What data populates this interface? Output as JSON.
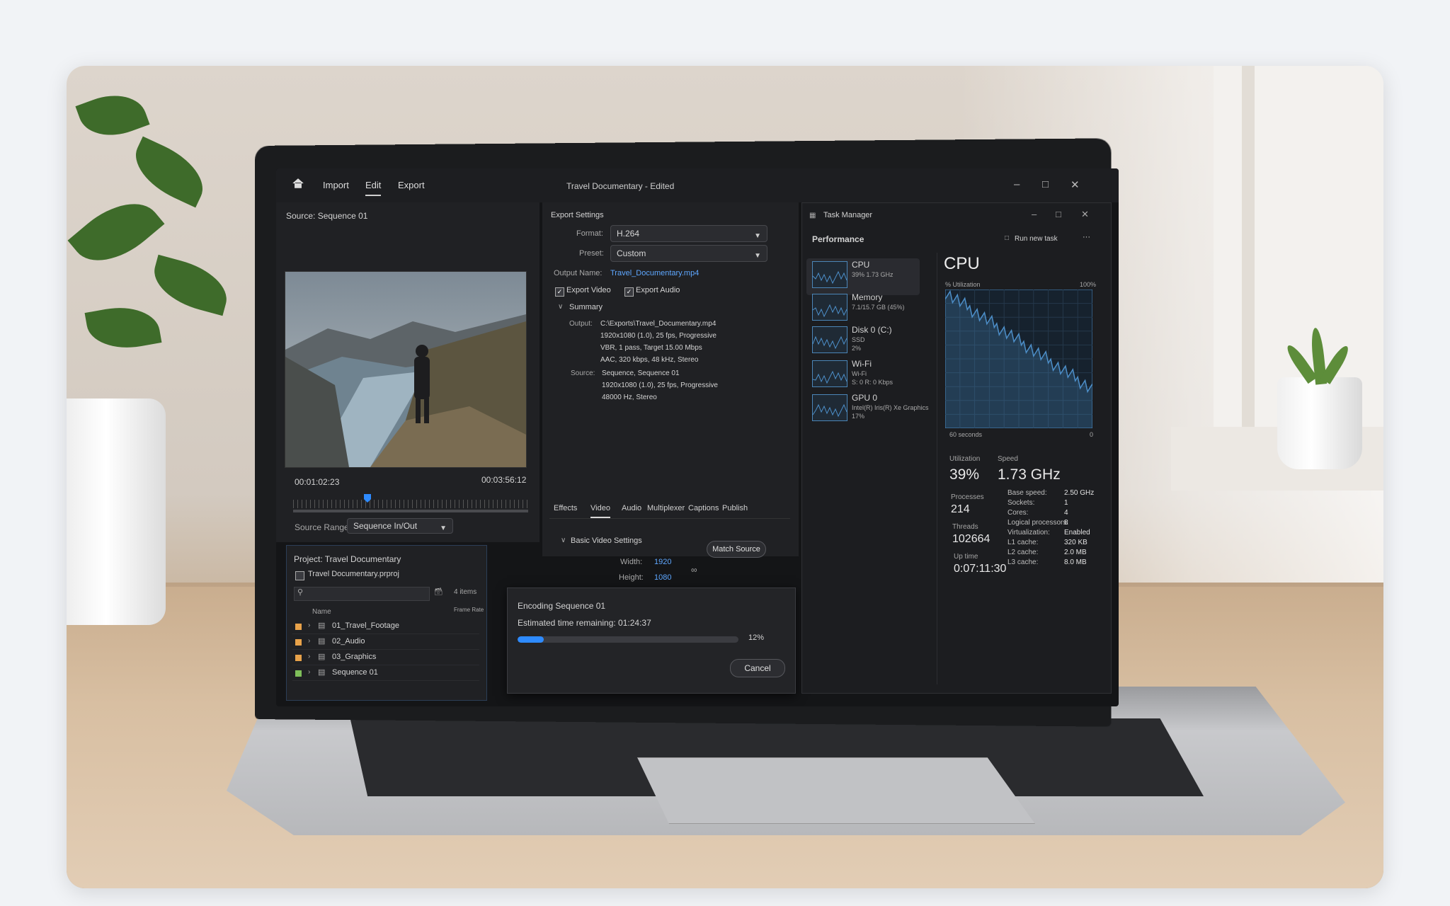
{
  "titlebar": {
    "menu": [
      "Import",
      "Edit",
      "Export"
    ],
    "title": "Travel Documentary - Edited"
  },
  "source_panel": {
    "source_label": "Source: Sequence 01",
    "timecode_current": "00:01:02:23",
    "timecode_total": "00:03:56:12",
    "source_range_label": "Source Range:",
    "source_range_value": "Sequence In/Out"
  },
  "project_panel": {
    "title": "Project: Travel Documentary",
    "project_file": "Travel Documentary.prproj",
    "items_count": "4 items",
    "col_name": "Name",
    "col_rate": "Frame Rate",
    "items": [
      {
        "label": "01_Travel_Footage",
        "color": "#e8a24a"
      },
      {
        "label": "02_Audio",
        "color": "#e8a24a"
      },
      {
        "label": "03_Graphics",
        "color": "#e8a24a"
      },
      {
        "label": "Sequence 01",
        "color": "#7fbf5a"
      }
    ]
  },
  "export_settings": {
    "heading": "Export Settings",
    "format_label": "Format:",
    "format_value": "H.264",
    "preset_label": "Preset:",
    "preset_value": "Custom",
    "output_name_label": "Output Name:",
    "output_name_value": "Travel_Documentary.mp4",
    "export_video_label": "Export Video",
    "export_audio_label": "Export Audio",
    "summary_label": "Summary",
    "output_label": "Output:",
    "output_lines": [
      "C:\\Exports\\Travel_Documentary.mp4",
      "1920x1080 (1.0), 25 fps, Progressive",
      "VBR, 1 pass, Target 15.00 Mbps",
      "AAC, 320 kbps, 48 kHz, Stereo"
    ],
    "source_label": "Source:",
    "source_lines": [
      "Sequence, Sequence 01",
      "1920x1080 (1.0), 25 fps, Progressive",
      "48000 Hz, Stereo"
    ],
    "tabs": [
      "Effects",
      "Video",
      "Audio",
      "Multiplexer",
      "Captions",
      "Publish"
    ],
    "basic_video_label": "Basic Video Settings",
    "match_source_label": "Match Source",
    "width_label": "Width:",
    "width_value": "1920",
    "height_label": "Height:",
    "height_value": "1080"
  },
  "encoding_dialog": {
    "title": "Encoding Sequence 01",
    "remaining": "Estimated time remaining: 01:24:37",
    "percent_label": "12%",
    "progress_fraction": 0.12,
    "cancel_label": "Cancel",
    "accent": "#2e8bff"
  },
  "task_manager": {
    "title": "Task Manager",
    "section": "Performance",
    "run_new_task": "Run new task",
    "more": "···",
    "sidebar": [
      {
        "name": "CPU",
        "detail": "39% 1.73 GHz",
        "detail2": "",
        "detail3": ""
      },
      {
        "name": "Memory",
        "detail": "7.1/15.7 GB (45%)",
        "detail2": "",
        "detail3": ""
      },
      {
        "name": "Disk 0 (C:)",
        "detail": "SSD",
        "detail2": "2%",
        "detail3": ""
      },
      {
        "name": "Wi-Fi",
        "detail": "Wi-Fi",
        "detail2": "S: 0 R: 0 Kbps",
        "detail3": ""
      },
      {
        "name": "GPU 0",
        "detail": "Intel(R) Iris(R) Xe Graphics",
        "detail2": "17%",
        "detail3": ""
      }
    ],
    "cpu_heading": "CPU",
    "util_axis_label": "% Utilization",
    "util_axis_max": "100%",
    "time_axis_label": "60 seconds",
    "time_axis_end": "0",
    "utilization_label": "Utilization",
    "utilization_value": "39%",
    "speed_label": "Speed",
    "speed_value": "1.73 GHz",
    "processes_label": "Processes",
    "processes_value": "214",
    "threads_label": "Threads",
    "threads_value": "102664",
    "uptime_label": "Up time",
    "uptime_value": "0:07:11:30",
    "specs": [
      {
        "k": "Base speed:",
        "v": "2.50 GHz"
      },
      {
        "k": "Sockets:",
        "v": "1"
      },
      {
        "k": "Cores:",
        "v": "4"
      },
      {
        "k": "Logical processors:",
        "v": "8"
      },
      {
        "k": "Virtualization:",
        "v": "Enabled"
      },
      {
        "k": "L1 cache:",
        "v": "320 KB"
      },
      {
        "k": "L2 cache:",
        "v": "2.0 MB"
      },
      {
        "k": "L3 cache:",
        "v": "8.0 MB"
      }
    ],
    "graph_color": "#4d8fc9"
  }
}
